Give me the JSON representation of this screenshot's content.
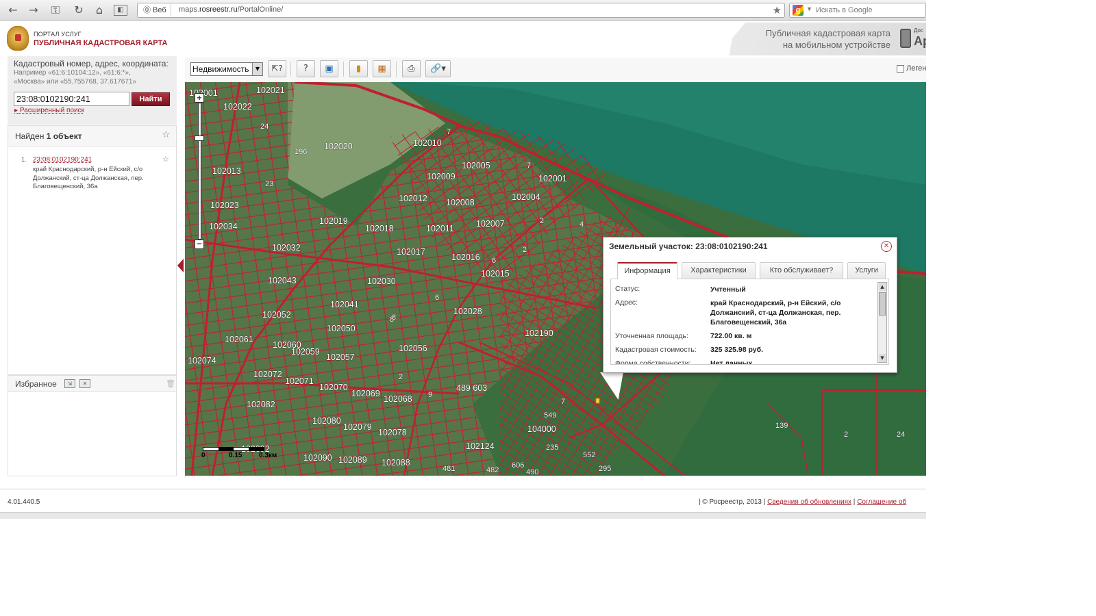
{
  "browser": {
    "web_label": "Веб",
    "url_prefix": "maps.",
    "url_domain": "rosreestr.ru",
    "url_path": "/PortalOnline/",
    "search_placeholder": "Искать в Google",
    "icons": [
      "back-icon",
      "forward-icon",
      "key-icon",
      "reload-icon",
      "home-icon",
      "reader-icon",
      "star-icon"
    ]
  },
  "header": {
    "portal_label": "ПОРТАЛ УСЛУГ",
    "title": "ПУБЛИЧНАЯ КАДАСТРОВАЯ КАРТА",
    "mobile_line1": "Публичная кадастровая карта",
    "mobile_line2": "на мобильном устройстве",
    "app_small": "Дос",
    "app_big": "Ap"
  },
  "search": {
    "label": "Кадастровый номер, адрес, координата:",
    "hint1": "Например «61:6:10104:12», «61:6:*»,",
    "hint2": "«Москва» или «55.755768, 37.617671»",
    "value": "23:08:0102190:241",
    "button": "Найти",
    "advanced": "Расширенный поиск"
  },
  "results": {
    "found_prefix": "Найден",
    "found_count": "1 объект",
    "items": [
      {
        "num": "1.",
        "id": "23:08:0102190:241",
        "address": "край Краснодарский, р-н Ейский, с/о Должанский, ст-ца Должанская, пер. Благовещенский, 36а"
      }
    ]
  },
  "favorites": {
    "title": "Избранное"
  },
  "toolbar": {
    "layer": "Недвижимость",
    "legend": "Леген",
    "icons": [
      "select-info-icon",
      "measure-icon",
      "identify-icon",
      "ruler-icon",
      "cadastral-icon",
      "print-icon",
      "link-icon"
    ]
  },
  "map": {
    "scale_mid": "0.15",
    "scale_end": "0.3км",
    "labels": [
      {
        "t": "102001"
      },
      {
        "t": "102021"
      },
      {
        "t": "102022"
      },
      {
        "t": "24"
      },
      {
        "t": "196"
      },
      {
        "t": "102020"
      },
      {
        "t": "102013"
      },
      {
        "t": "23"
      },
      {
        "t": "102023"
      },
      {
        "t": "102034"
      },
      {
        "t": "102010"
      },
      {
        "t": "7"
      },
      {
        "t": "102005"
      },
      {
        "t": "102009"
      },
      {
        "t": "102001"
      },
      {
        "t": "7"
      },
      {
        "t": "102012"
      },
      {
        "t": "102008"
      },
      {
        "t": "102004"
      },
      {
        "t": "102019"
      },
      {
        "t": "102018"
      },
      {
        "t": "102011"
      },
      {
        "t": "102007"
      },
      {
        "t": "2"
      },
      {
        "t": "4"
      },
      {
        "t": "102032"
      },
      {
        "t": "102017"
      },
      {
        "t": "102016"
      },
      {
        "t": "2"
      },
      {
        "t": "6"
      },
      {
        "t": "102015"
      },
      {
        "t": "102043"
      },
      {
        "t": "102030"
      },
      {
        "t": "6"
      },
      {
        "t": "102041"
      },
      {
        "t": "102028"
      },
      {
        "t": "102052"
      },
      {
        "t": "8"
      },
      {
        "t": "102050"
      },
      {
        "t": "102190"
      },
      {
        "t": "102061"
      },
      {
        "t": "102060"
      },
      {
        "t": "102059"
      },
      {
        "t": "102057"
      },
      {
        "t": "102056"
      },
      {
        "t": "102074"
      },
      {
        "t": "102072"
      },
      {
        "t": "102071"
      },
      {
        "t": "102070"
      },
      {
        "t": "102069"
      },
      {
        "t": "102068"
      },
      {
        "t": "9"
      },
      {
        "t": "489 603"
      },
      {
        "t": "102082"
      },
      {
        "t": "7"
      },
      {
        "t": "102080"
      },
      {
        "t": "102079"
      },
      {
        "t": "102078"
      },
      {
        "t": "549"
      },
      {
        "t": "104000"
      },
      {
        "t": "139"
      },
      {
        "t": "2"
      },
      {
        "t": "24"
      },
      {
        "t": "102124"
      },
      {
        "t": "235"
      },
      {
        "t": "102092"
      },
      {
        "t": "102090"
      },
      {
        "t": "102089"
      },
      {
        "t": "102088"
      },
      {
        "t": "552"
      },
      {
        "t": "481"
      },
      {
        "t": "482"
      },
      {
        "t": "606"
      },
      {
        "t": "490"
      },
      {
        "t": "295"
      },
      {
        "t": "2"
      },
      {
        "t": "8"
      }
    ]
  },
  "popup": {
    "title": "Земельный участок: 23:08:0102190:241",
    "tabs": [
      "Информация",
      "Характеристики",
      "Кто обслуживает?",
      "Услуги"
    ],
    "rows": [
      {
        "label": "Статус:",
        "value": "Учтенный"
      },
      {
        "label": "Адрес:",
        "value": "край Краснодарский, р-н Ейский, с/о Должанский, ст-ца Должанская, пер. Благовещенский, 36а"
      },
      {
        "label": "Уточненная площадь:",
        "value": "722.00 кв. м"
      },
      {
        "label": "Кадастровая стоимость:",
        "value": "325 325.98 руб."
      },
      {
        "label": "Форма собственности:",
        "value": "Нет данных"
      }
    ]
  },
  "footer": {
    "version": "4.01.440.5",
    "copyright": "| © Росреестр, 2013 |",
    "updates_link": "Сведения об обновлениях",
    "sep": "|",
    "agreement_link": "Соглашение об"
  },
  "colors": {
    "brand": "#a41d2b",
    "boundary": "#c0202e",
    "map_green": "#2d6a3c",
    "sea": "#1f7a63"
  }
}
